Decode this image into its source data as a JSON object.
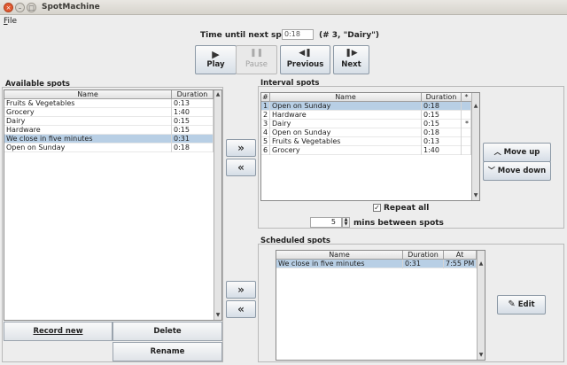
{
  "window": {
    "title": "SpotMachine",
    "close_glyph": "×",
    "min_glyph": "–",
    "max_glyph": "□"
  },
  "menubar": {
    "file": "File"
  },
  "countdown": {
    "label": "Time until next spot:",
    "value": "0:18",
    "info": "(# 3, \"Dairy\")"
  },
  "controls": {
    "play": "Play",
    "pause": "Pause",
    "previous": "Previous",
    "next": "Next",
    "play_icon": "▶",
    "pause_icon": "❚❚",
    "previous_icon": "◀❚",
    "next_icon": "❚▶"
  },
  "available": {
    "title": "Available spots",
    "columns": [
      "Name",
      "Duration"
    ],
    "rows": [
      {
        "name": "Fruits & Vegetables",
        "duration": "0:13"
      },
      {
        "name": "Grocery",
        "duration": "1:40"
      },
      {
        "name": "Dairy",
        "duration": "0:15"
      },
      {
        "name": "Hardware",
        "duration": "0:15"
      },
      {
        "name": "We close in five minutes",
        "duration": "0:31"
      },
      {
        "name": "Open on Sunday",
        "duration": "0:18"
      }
    ],
    "selected_index": 4,
    "record_new": "Record new",
    "delete": "Delete",
    "rename": "Rename"
  },
  "interval": {
    "title": "Interval spots",
    "columns": [
      "#",
      "Name",
      "Duration",
      "*"
    ],
    "rows": [
      {
        "num": "1",
        "name": "Open on Sunday",
        "duration": "0:18",
        "mark": ""
      },
      {
        "num": "2",
        "name": "Hardware",
        "duration": "0:15",
        "mark": ""
      },
      {
        "num": "3",
        "name": "Dairy",
        "duration": "0:15",
        "mark": "*"
      },
      {
        "num": "4",
        "name": "Open on Sunday",
        "duration": "0:18",
        "mark": ""
      },
      {
        "num": "5",
        "name": "Fruits & Vegetables",
        "duration": "0:13",
        "mark": ""
      },
      {
        "num": "6",
        "name": "Grocery",
        "duration": "1:40",
        "mark": ""
      }
    ],
    "selected_index": 0,
    "move_up": "Move up",
    "move_down": "Move down",
    "repeat_all": "Repeat all",
    "mins_value": "5",
    "mins_label": "mins between spots"
  },
  "scheduled": {
    "title": "Scheduled spots",
    "columns": [
      "Name",
      "Duration",
      "At"
    ],
    "rows": [
      {
        "name": "We close in five minutes",
        "duration": "0:31",
        "at": "7:55 PM"
      }
    ],
    "edit": "Edit"
  },
  "arrows": {
    "right": "»",
    "left": "«"
  },
  "colors": {
    "selection": "#b8cfe5",
    "titlebar_close": "#e0582f"
  }
}
